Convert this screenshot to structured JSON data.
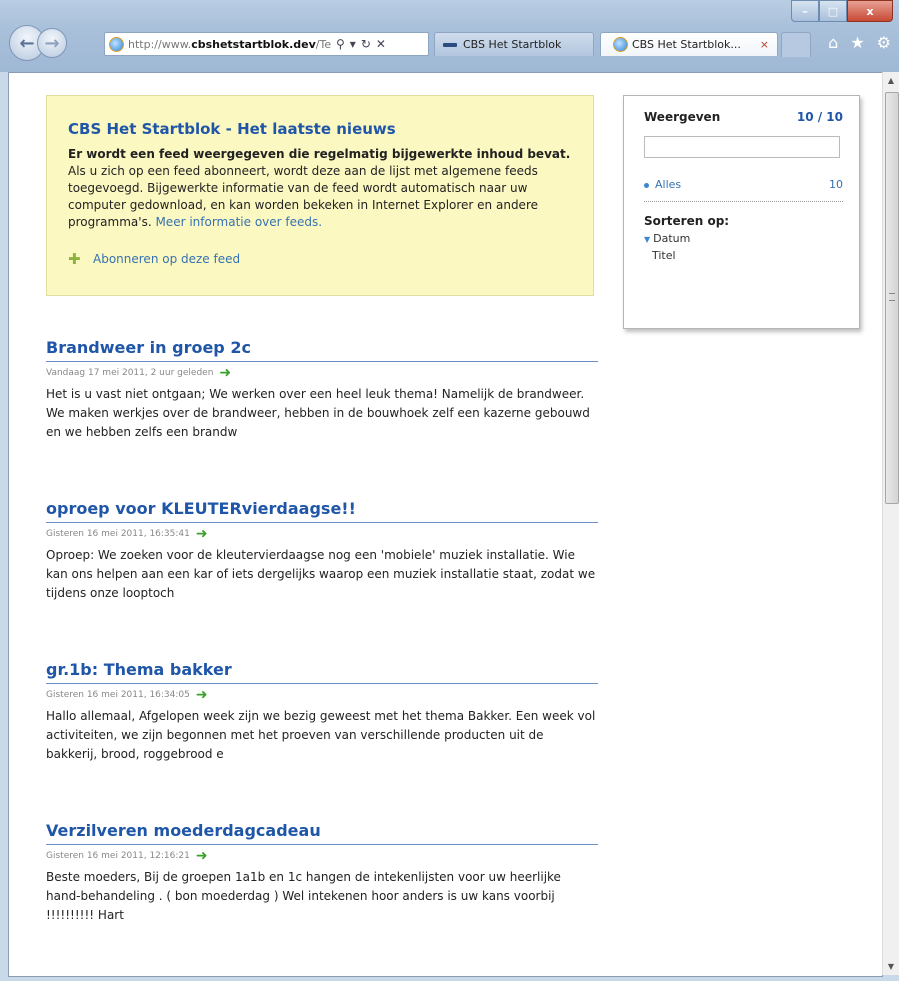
{
  "browser": {
    "url_prefix": "http://www.",
    "url_domain": "cbshetstartblok.dev",
    "url_suffix": "/Te",
    "tabs": [
      {
        "label": "CBS Het Startblok"
      },
      {
        "label": "CBS Het Startblok...",
        "close": "×"
      }
    ],
    "window_controls": {
      "minimize": "–",
      "maximize": "□",
      "close": "x"
    },
    "address_tools": {
      "search": "⚲",
      "dropdown": "▾",
      "refresh": "↻",
      "stop": "✕"
    }
  },
  "feed": {
    "title": "CBS Het Startblok - Het laatste nieuws",
    "desc_bold": "Er wordt een feed weergegeven die regelmatig bijgewerkte inhoud bevat.",
    "desc_text": " Als u zich op een feed abonneert, wordt deze aan de lijst met algemene feeds toegevoegd. Bijgewerkte informatie van de feed wordt automatisch naar uw computer gedownload, en kan worden bekeken in Internet Explorer en andere programma's. ",
    "desc_link": "Meer informatie over feeds.",
    "subscribe_label": "Abonneren op deze feed"
  },
  "side_panel": {
    "display_label": "Weergeven",
    "display_count": "10 / 10",
    "all_label": "Alles",
    "all_count": "10",
    "sort_label": "Sorteren op:",
    "sort_options": [
      "Datum",
      "Titel"
    ]
  },
  "articles": [
    {
      "title": "Brandweer in groep 2c",
      "date": "Vandaag 17 mei 2011, 2 uur geleden",
      "body": "Het is u vast niet ontgaan; We werken over een heel leuk thema! Namelijk de brandweer. We maken werkjes over de brandweer, hebben in de bouwhoek zelf een kazerne gebouwd en we hebben zelfs een brandw"
    },
    {
      "title": "oproep voor KLEUTERvierdaagse!!",
      "date": "Gisteren 16 mei 2011, 16:35:41",
      "body": "Oproep: We zoeken voor de kleutervierdaagse nog een 'mobiele' muziek installatie. Wie kan ons helpen aan een kar of iets dergelijks waarop een muziek installatie staat, zodat we tijdens onze looptoch"
    },
    {
      "title": "gr.1b: Thema bakker",
      "date": "Gisteren 16 mei 2011, 16:34:05",
      "body": "Hallo allemaal, Afgelopen week zijn we bezig geweest met het thema Bakker. Een week vol activiteiten, we zijn begonnen met het proeven van verschillende producten uit de bakkerij, brood, roggebrood e"
    },
    {
      "title": "Verzilveren moederdagcadeau",
      "date": "Gisteren 16 mei 2011, 12:16:21",
      "body": "Beste moeders, Bij de groepen 1a1b en 1c hangen de intekenlijsten voor uw heerlijke hand-behandeling . ( bon moederdag ) Wel intekenen hoor anders is uw kans voorbij !!!!!!!!!! Hart"
    }
  ],
  "colors": {
    "link": "#1f56a8",
    "header_bg": "#fcf8c2",
    "accent_green": "#3aa12b"
  }
}
